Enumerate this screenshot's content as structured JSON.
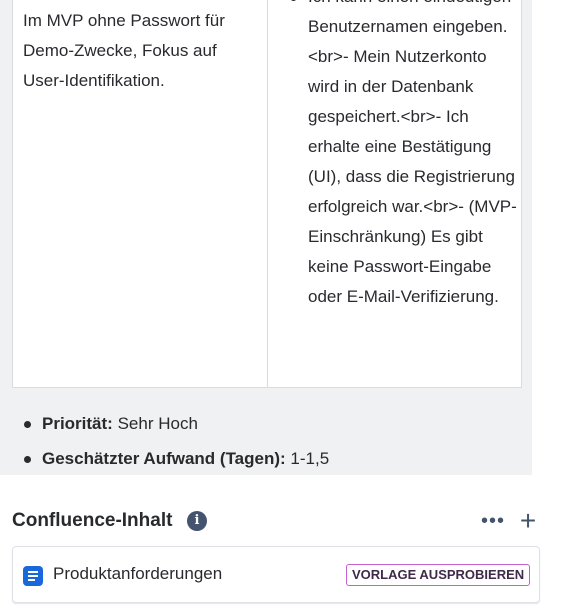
{
  "table": {
    "left_cell_text": "Im MVP ohne Passwort für Demo-Zwecke, Fokus auf User-Identifikation.",
    "right_cell_items": [
      "Ich kann einen eindeutigen Benutzernamen eingeben. <br>- Mein Nutzerkonto wird in der Datenbank gespeichert.<br>- Ich erhalte eine Bestätigung (UI), dass die Registrierung erfolgreich war.<br>- (MVP-Einschränkung) Es gibt keine Passwort-Eingabe oder E-Mail-Verifizierung."
    ]
  },
  "properties": [
    {
      "label": "Priorität:",
      "value": "Sehr Hoch"
    },
    {
      "label": "Geschätzter Aufwand (Tagen):",
      "value": "1-1,5"
    }
  ],
  "confluence": {
    "title": "Confluence-Inhalt",
    "info_icon": "i",
    "more_icon": "•••",
    "add_icon": "+",
    "card": {
      "label": "Produktanforderungen",
      "button": "VORLAGE AUSPROBIEREN"
    }
  },
  "colors": {
    "accent_blue": "#1868db",
    "try_border": "#c55fcf",
    "panel_bg": "#f0f1f2"
  }
}
